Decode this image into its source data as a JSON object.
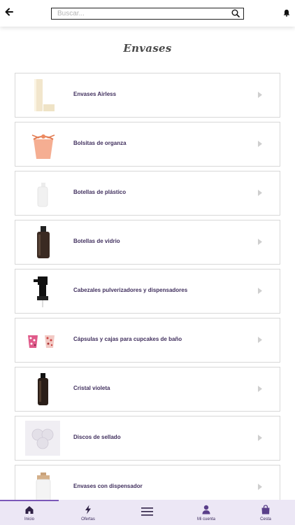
{
  "header": {
    "search_placeholder": "Buscar...",
    "back_icon": "arrow-left-icon",
    "search_icon": "search-icon",
    "bell_icon": "bell-icon"
  },
  "page": {
    "title": "Envases"
  },
  "categories": [
    {
      "label": "Envases Airless",
      "icon": "airless-bottle-image"
    },
    {
      "label": "Bolsitas de organza",
      "icon": "organza-bag-image"
    },
    {
      "label": "Botellas de plástico",
      "icon": "plastic-bottle-image"
    },
    {
      "label": "Botellas de vidrio",
      "icon": "glass-bottle-image"
    },
    {
      "label": "Cabezales pulverizadores y dispensadores",
      "icon": "pump-head-image"
    },
    {
      "label": "Cápsulas y cajas para cupcakes de baño",
      "icon": "cupcake-cases-image"
    },
    {
      "label": "Cristal violeta",
      "icon": "violet-glass-bottle-image"
    },
    {
      "label": "Discos de sellado",
      "icon": "sealing-discs-image"
    },
    {
      "label": "Envases con dispensador",
      "icon": "dispenser-bottle-image"
    }
  ],
  "bottom_nav": [
    {
      "label": "Inicio",
      "icon": "home-icon",
      "active": true
    },
    {
      "label": "Ofertas",
      "icon": "lightning-icon"
    },
    {
      "label": "",
      "icon": "menu-icon"
    },
    {
      "label": "Mi cuenta",
      "icon": "user-icon"
    },
    {
      "label": "Cesta",
      "icon": "shopping-bag-icon"
    }
  ],
  "colors": {
    "accent": "#7b58b8",
    "label_text": "#41305e",
    "nav_background": "#ece7f5"
  }
}
